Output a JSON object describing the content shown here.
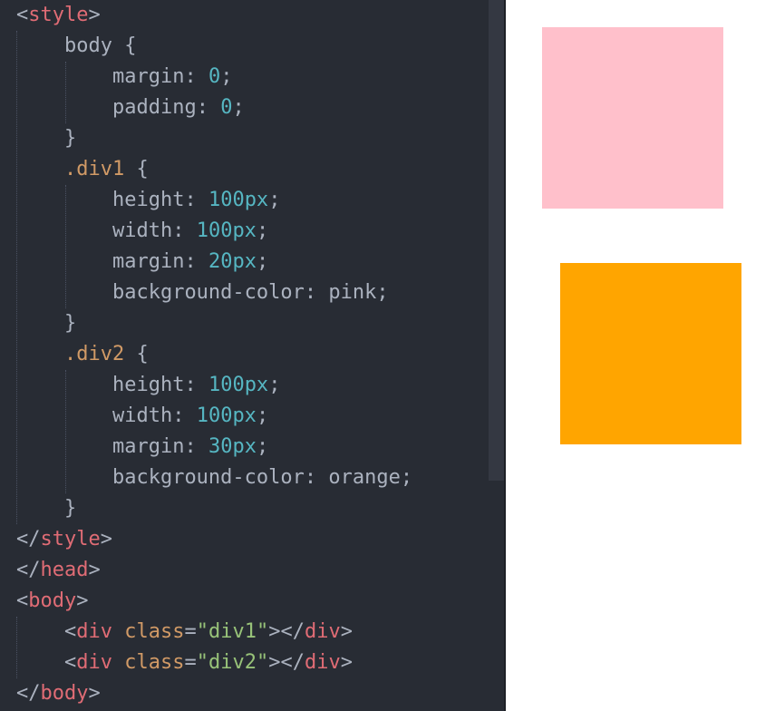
{
  "editor": {
    "lines": [
      [
        {
          "t": "<",
          "c": "punc"
        },
        {
          "t": "style",
          "c": "tag"
        },
        {
          "t": ">",
          "c": "punc"
        }
      ],
      [
        {
          "t": "    "
        },
        {
          "t": "body",
          "c": "prop"
        },
        {
          "t": " {",
          "c": "punc"
        }
      ],
      [
        {
          "t": "        "
        },
        {
          "t": "margin",
          "c": "prop"
        },
        {
          "t": ": ",
          "c": "punc"
        },
        {
          "t": "0",
          "c": "num"
        },
        {
          "t": ";",
          "c": "punc"
        }
      ],
      [
        {
          "t": "        "
        },
        {
          "t": "padding",
          "c": "prop"
        },
        {
          "t": ": ",
          "c": "punc"
        },
        {
          "t": "0",
          "c": "num"
        },
        {
          "t": ";",
          "c": "punc"
        }
      ],
      [
        {
          "t": "    "
        },
        {
          "t": "}",
          "c": "punc"
        }
      ],
      [
        {
          "t": "    "
        },
        {
          "t": ".div1",
          "c": "sel"
        },
        {
          "t": " {",
          "c": "punc"
        }
      ],
      [
        {
          "t": "        "
        },
        {
          "t": "height",
          "c": "prop"
        },
        {
          "t": ": ",
          "c": "punc"
        },
        {
          "t": "100px",
          "c": "num"
        },
        {
          "t": ";",
          "c": "punc"
        }
      ],
      [
        {
          "t": "        "
        },
        {
          "t": "width",
          "c": "prop"
        },
        {
          "t": ": ",
          "c": "punc"
        },
        {
          "t": "100px",
          "c": "num"
        },
        {
          "t": ";",
          "c": "punc"
        }
      ],
      [
        {
          "t": "        "
        },
        {
          "t": "margin",
          "c": "prop"
        },
        {
          "t": ": ",
          "c": "punc"
        },
        {
          "t": "20px",
          "c": "num"
        },
        {
          "t": ";",
          "c": "punc"
        }
      ],
      [
        {
          "t": "        "
        },
        {
          "t": "background-color",
          "c": "prop"
        },
        {
          "t": ": ",
          "c": "punc"
        },
        {
          "t": "pink",
          "c": "kw"
        },
        {
          "t": ";",
          "c": "punc"
        }
      ],
      [
        {
          "t": "    "
        },
        {
          "t": "}",
          "c": "punc"
        }
      ],
      [
        {
          "t": "    "
        },
        {
          "t": ".div2",
          "c": "sel"
        },
        {
          "t": " {",
          "c": "punc"
        }
      ],
      [
        {
          "t": "        "
        },
        {
          "t": "height",
          "c": "prop"
        },
        {
          "t": ": ",
          "c": "punc"
        },
        {
          "t": "100px",
          "c": "num"
        },
        {
          "t": ";",
          "c": "punc"
        }
      ],
      [
        {
          "t": "        "
        },
        {
          "t": "width",
          "c": "prop"
        },
        {
          "t": ": ",
          "c": "punc"
        },
        {
          "t": "100px",
          "c": "num"
        },
        {
          "t": ";",
          "c": "punc"
        }
      ],
      [
        {
          "t": "        "
        },
        {
          "t": "margin",
          "c": "prop"
        },
        {
          "t": ": ",
          "c": "punc"
        },
        {
          "t": "30px",
          "c": "num"
        },
        {
          "t": ";",
          "c": "punc"
        }
      ],
      [
        {
          "t": "        "
        },
        {
          "t": "background-color",
          "c": "prop"
        },
        {
          "t": ": ",
          "c": "punc"
        },
        {
          "t": "orange",
          "c": "kw"
        },
        {
          "t": ";",
          "c": "punc"
        }
      ],
      [
        {
          "t": "    "
        },
        {
          "t": "}",
          "c": "punc"
        }
      ],
      [
        {
          "t": "</",
          "c": "punc"
        },
        {
          "t": "style",
          "c": "tag"
        },
        {
          "t": ">",
          "c": "punc"
        }
      ],
      [
        {
          "t": "</",
          "c": "punc"
        },
        {
          "t": "head",
          "c": "tag"
        },
        {
          "t": ">",
          "c": "punc"
        }
      ],
      [
        {
          "t": "<",
          "c": "punc"
        },
        {
          "t": "body",
          "c": "tag"
        },
        {
          "t": ">",
          "c": "punc"
        }
      ],
      [
        {
          "t": "    "
        },
        {
          "t": "<",
          "c": "punc"
        },
        {
          "t": "div",
          "c": "tag"
        },
        {
          "t": " "
        },
        {
          "t": "class",
          "c": "attr"
        },
        {
          "t": "=",
          "c": "punc"
        },
        {
          "t": "\"div1\"",
          "c": "str"
        },
        {
          "t": "></",
          "c": "punc"
        },
        {
          "t": "div",
          "c": "tag"
        },
        {
          "t": ">",
          "c": "punc"
        }
      ],
      [
        {
          "t": "    "
        },
        {
          "t": "<",
          "c": "punc"
        },
        {
          "t": "div",
          "c": "tag"
        },
        {
          "t": " "
        },
        {
          "t": "class",
          "c": "attr"
        },
        {
          "t": "=",
          "c": "punc"
        },
        {
          "t": "\"div2\"",
          "c": "str"
        },
        {
          "t": "></",
          "c": "punc"
        },
        {
          "t": "div",
          "c": "tag"
        },
        {
          "t": ">",
          "c": "punc"
        }
      ],
      [
        {
          "t": "</",
          "c": "punc"
        },
        {
          "t": "body",
          "c": "tag"
        },
        {
          "t": ">",
          "c": "punc"
        }
      ]
    ]
  },
  "preview": {
    "div1_color": "#ffc0cb",
    "div2_color": "#ffa500"
  }
}
